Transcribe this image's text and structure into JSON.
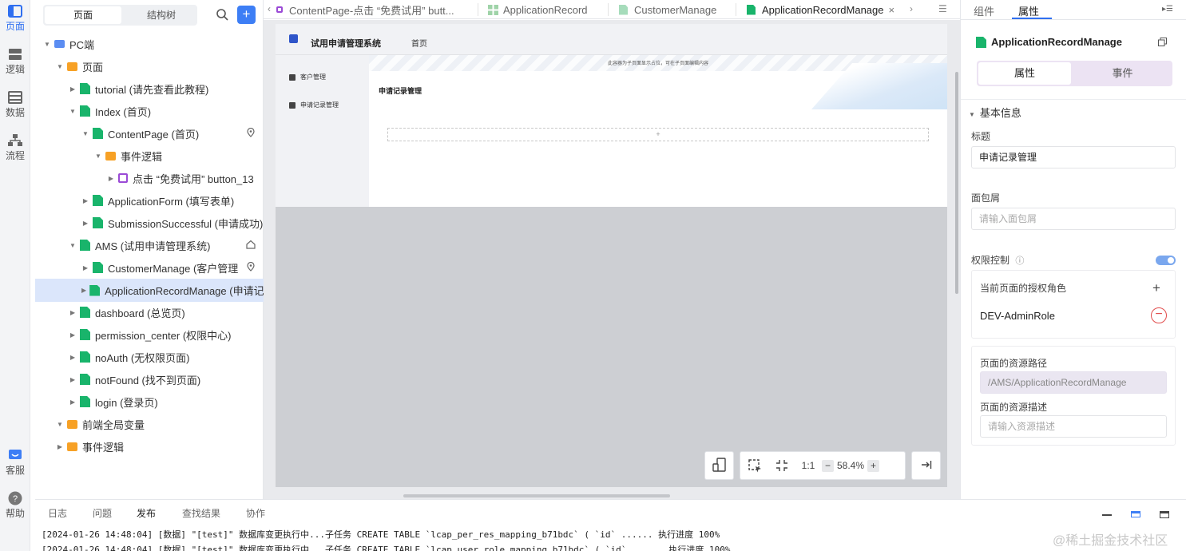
{
  "rail": {
    "items": [
      {
        "label": "页面",
        "icon": "page-layout-icon",
        "active": true
      },
      {
        "label": "逻辑",
        "icon": "logic-icon",
        "active": false
      },
      {
        "label": "数据",
        "icon": "data-table-icon",
        "active": false
      },
      {
        "label": "流程",
        "icon": "flow-icon",
        "active": false
      }
    ],
    "bottom": [
      {
        "label": "客服",
        "icon": "support-chat-icon"
      },
      {
        "label": "帮助",
        "icon": "help-icon"
      }
    ]
  },
  "tree_panel": {
    "seg_pages": "页面",
    "seg_structure": "结构树",
    "add_label": "+",
    "nodes": [
      "PC端",
      "页面",
      "tutorial (请先查看此教程)",
      "Index (首页)",
      "ContentPage (首页)",
      "事件逻辑",
      "点击 “免费试用” button_13",
      "ApplicationForm (填写表单)",
      "SubmissionSuccessful (申请成功)",
      "AMS (试用申请管理系统)",
      "CustomerManage (客户管理",
      "ApplicationRecordManage (申请记",
      "dashboard (总览页)",
      "permission_center (权限中心)",
      "noAuth (无权限页面)",
      "notFound (找不到页面)",
      "login (登录页)",
      "前端全局变量",
      "事件逻辑"
    ]
  },
  "tabs": [
    {
      "label": "ContentPage-点击 “免费试用” butt...",
      "icon": "logic-icon"
    },
    {
      "label": "ApplicationRecord",
      "icon": "component-icon"
    },
    {
      "label": "CustomerManage",
      "icon": "page-icon"
    },
    {
      "label": "ApplicationRecordManage",
      "icon": "page-icon",
      "active": true
    }
  ],
  "canvas": {
    "app_title": "试用申请管理系统",
    "nav_home": "首页",
    "side_items": [
      "客户管理",
      "申请记录管理"
    ],
    "banner_tip": "此容器为子页面显示占位，可在子页面编辑内容",
    "main_title": "申请记录管理",
    "add_slot": "+",
    "zoom_ratio": "1:1",
    "zoom_minus": "−",
    "zoom_level": "58.4%",
    "zoom_plus": "+"
  },
  "props": {
    "tab_components": "组件",
    "tab_properties": "属性",
    "component_name": "ApplicationRecordManage",
    "seg_attrs": "属性",
    "seg_events": "事件",
    "section_basic": "基本信息",
    "title_label": "标题",
    "title_value": "申请记录管理",
    "breadcrumb_label": "面包屑",
    "breadcrumb_placeholder": "请输入面包屑",
    "auth_label": "权限控制",
    "roles_label": "当前页面的授权角色",
    "role_add": "+",
    "role_name": "DEV-AdminRole",
    "role_remove": "−",
    "resource_path_label": "页面的资源路径",
    "resource_path_value": "/AMS/ApplicationRecordManage",
    "resource_desc_label": "页面的资源描述",
    "resource_desc_placeholder": "请输入资源描述"
  },
  "bottom": {
    "tabs": [
      "日志",
      "问题",
      "发布",
      "查找结果",
      "协作"
    ],
    "active_tab": "发布",
    "logs": [
      "[2024-01-26 14:48:04] [数据] \"[test]\" 数据库变更执行中...子任务 CREATE TABLE `lcap_per_res_mapping_b71bdc` ( `id` ...... 执行进度 100%",
      "[2024-01-26 14:48:04] [数据] \"[test]\" 数据库变更执行中...子任务 CREATE TABLE `lcap_user_role_mapping_b71bdc` ( `id` ...... 执行进度 100%"
    ],
    "watermark": "@稀土掘金技术社区"
  }
}
